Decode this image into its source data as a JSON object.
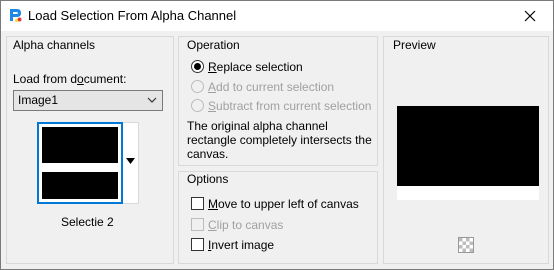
{
  "window": {
    "title": "Load Selection From Alpha Channel"
  },
  "alpha_channels": {
    "title": "Alpha channels",
    "load_from_label": "Load from document:",
    "document_value": "Image1",
    "thumbnail_caption": "Selectie 2"
  },
  "operation": {
    "title": "Operation",
    "options": [
      {
        "label": "Replace selection",
        "selected": true,
        "enabled": true
      },
      {
        "label": "Add to current selection",
        "selected": false,
        "enabled": false
      },
      {
        "label": "Subtract from current selection",
        "selected": false,
        "enabled": false
      }
    ],
    "note": "The original alpha channel rectangle completely intersects the canvas."
  },
  "options": {
    "title": "Options",
    "items": [
      {
        "label": "Move to upper left of canvas",
        "checked": false,
        "enabled": true
      },
      {
        "label": "Clip to canvas",
        "checked": false,
        "enabled": false
      },
      {
        "label": "Invert image",
        "checked": false,
        "enabled": true
      }
    ]
  },
  "preview": {
    "title": "Preview"
  },
  "icons": {
    "app": "paintshop-app-icon",
    "close": "close-icon",
    "dropdown": "chevron-down-icon",
    "thumb_dropdown": "caret-down-icon",
    "transparency": "checkerboard-icon"
  },
  "colors": {
    "accent": "#0078d7",
    "window_bg": "#f0f0f0",
    "disabled_text": "#a0a0a0"
  }
}
